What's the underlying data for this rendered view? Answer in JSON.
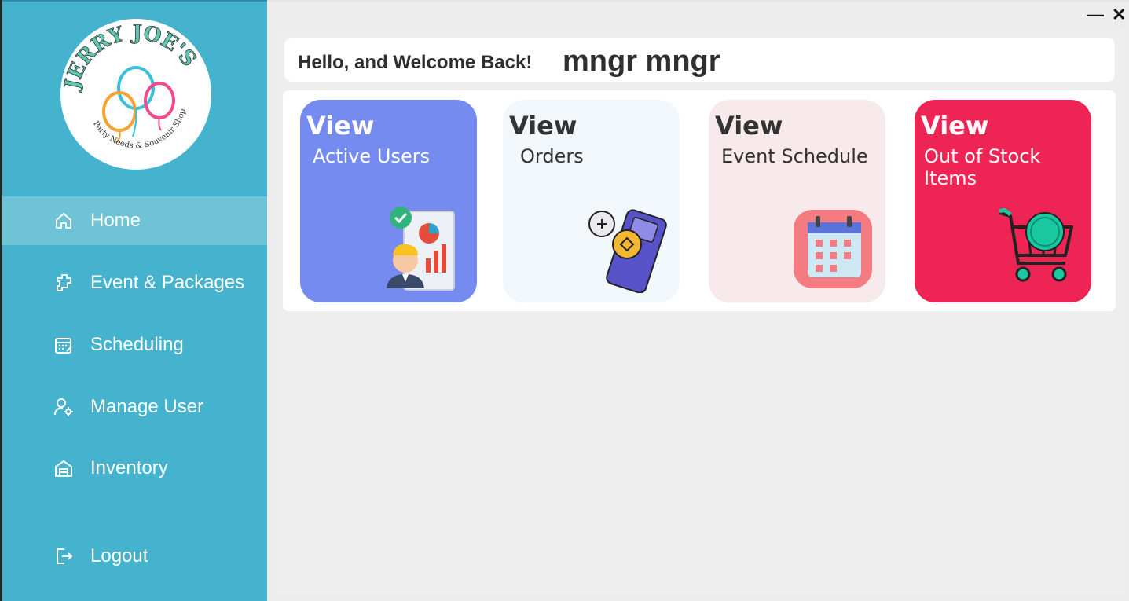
{
  "logo": {
    "brand": "JERRY JOE'S",
    "tagline": "Party Needs & Souvenir Shop"
  },
  "sidebar": {
    "items": [
      {
        "label": "Home",
        "icon": "home-icon",
        "active": true
      },
      {
        "label": "Event & Packages",
        "icon": "package-icon"
      },
      {
        "label": "Scheduling",
        "icon": "calendar-icon"
      },
      {
        "label": "Manage User",
        "icon": "user-gear-icon"
      },
      {
        "label": "Inventory",
        "icon": "warehouse-icon"
      }
    ],
    "logout": {
      "label": "Logout",
      "icon": "logout-icon"
    }
  },
  "window": {
    "minimize": "—",
    "close": "✕"
  },
  "header": {
    "greeting": "Hello, and Welcome Back!",
    "username": "mngr mngr"
  },
  "cards": [
    {
      "view": "View",
      "label": "Active Users",
      "icon": "user-report-icon",
      "bg": "#758bf0",
      "text": "#ffffff"
    },
    {
      "view": "View",
      "label": "Orders",
      "icon": "payment-terminal-icon",
      "bg": "#f2f7fb",
      "text": "#333333"
    },
    {
      "view": "View",
      "label": "Event Schedule",
      "icon": "calendar-icon",
      "bg": "#f8eaec",
      "text": "#333333"
    },
    {
      "view": "View",
      "label": "Out of Stock Items",
      "icon": "sold-out-cart-icon",
      "bg": "#ee2554",
      "text": "#ffffff"
    }
  ],
  "colors": {
    "sidebar": "#45b3cd",
    "sidebar_active": "#6ec3d6",
    "content_bg": "#eeeeee"
  }
}
